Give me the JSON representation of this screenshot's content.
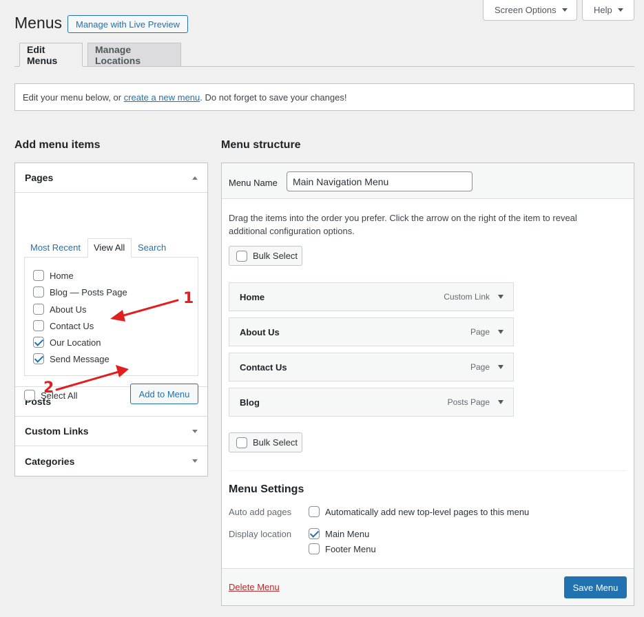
{
  "header": {
    "title": "Menus",
    "live_preview": "Manage with Live Preview",
    "screen_options": "Screen Options",
    "help": "Help"
  },
  "tabs": [
    {
      "label": "Edit Menus"
    },
    {
      "label": "Manage Locations"
    }
  ],
  "notice": {
    "prefix": "Edit your menu below, or ",
    "link": "create a new menu",
    "suffix": ". Do not forget to save your changes!"
  },
  "add_items": {
    "title": "Add menu items",
    "pages": {
      "label": "Pages",
      "subtabs": [
        "Most Recent",
        "View All",
        "Search"
      ],
      "items": [
        {
          "label": "Home",
          "checked": false
        },
        {
          "label": "Blog — Posts Page",
          "checked": false
        },
        {
          "label": "About Us",
          "checked": false
        },
        {
          "label": "Contact Us",
          "checked": false
        },
        {
          "label": "Our Location",
          "checked": true
        },
        {
          "label": "Send Message",
          "checked": true
        }
      ],
      "select_all": "Select All",
      "add_button": "Add to Menu"
    },
    "posts_label": "Posts",
    "custom_links_label": "Custom Links",
    "categories_label": "Categories"
  },
  "structure": {
    "title": "Menu structure",
    "menu_name_label": "Menu Name",
    "menu_name_value": "Main Navigation Menu",
    "instructions": "Drag the items into the order you prefer. Click the arrow on the right of the item to reveal additional configuration options.",
    "bulk_select": "Bulk Select",
    "items": [
      {
        "title": "Home",
        "type": "Custom Link"
      },
      {
        "title": "About Us",
        "type": "Page"
      },
      {
        "title": "Contact Us",
        "type": "Page"
      },
      {
        "title": "Blog",
        "type": "Posts Page"
      }
    ],
    "settings": {
      "title": "Menu Settings",
      "auto_add_label": "Auto add pages",
      "auto_add_option": "Automatically add new top-level pages to this menu",
      "display_label": "Display location",
      "locations": [
        {
          "label": "Main Menu",
          "checked": true
        },
        {
          "label": "Footer Menu",
          "checked": false
        }
      ]
    },
    "delete": "Delete Menu",
    "save": "Save Menu"
  },
  "annotations": [
    "1",
    "2"
  ],
  "colors": {
    "accent": "#2271b1",
    "annotation": "#e02020",
    "delete": "#b32d2e"
  }
}
